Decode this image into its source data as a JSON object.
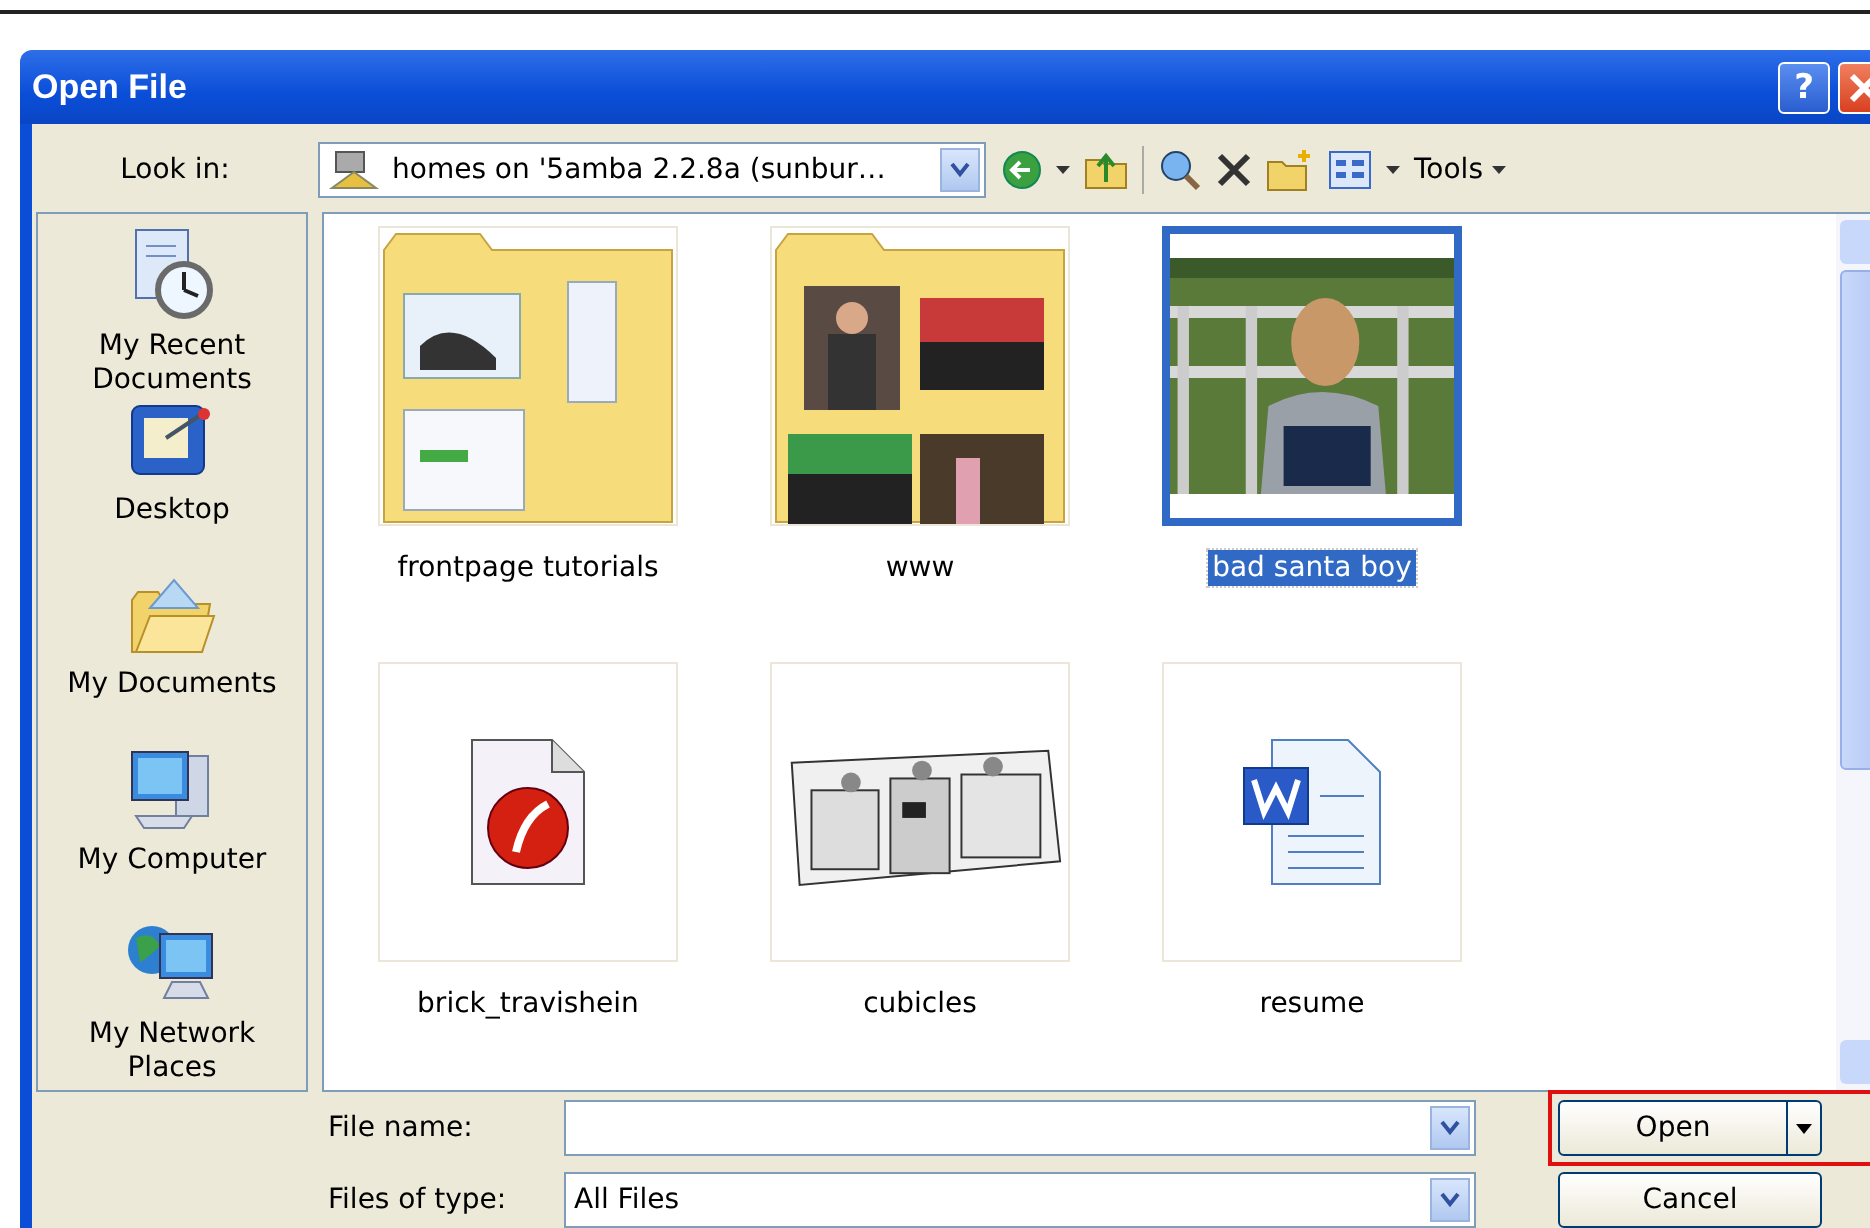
{
  "window": {
    "title": "Open File",
    "help": "?"
  },
  "look_in": {
    "label": "Look in:",
    "value": "homes on '5amba 2.2.8a (sunbur…"
  },
  "toolbar": {
    "tools": "Tools"
  },
  "places": [
    {
      "label": "My Recent Documents",
      "kind": "recent"
    },
    {
      "label": "Desktop",
      "kind": "desktop"
    },
    {
      "label": "My Documents",
      "kind": "documents"
    },
    {
      "label": "My Computer",
      "kind": "computer"
    },
    {
      "label": "My Network Places",
      "kind": "network"
    }
  ],
  "files": [
    {
      "name": "frontpage tutorials",
      "kind": "folder",
      "selected": false
    },
    {
      "name": "www",
      "kind": "photo-folder",
      "selected": false
    },
    {
      "name": "bad santa boy",
      "selected": true
    },
    {
      "name": "brick_travishein",
      "kind": "flash",
      "selected": false
    },
    {
      "name": "cubicles",
      "kind": "drawing",
      "selected": false
    },
    {
      "name": "resume",
      "kind": "word",
      "selected": false
    }
  ],
  "file_name": {
    "label": "File name:"
  },
  "file_type": {
    "label": "Files of type:",
    "value": "All Files"
  },
  "buttons": [
    {
      "label": "Open",
      "kind": "split",
      "highlighted": true
    },
    {
      "label": "Cancel",
      "kind": "plain",
      "highlighted": false
    }
  ]
}
